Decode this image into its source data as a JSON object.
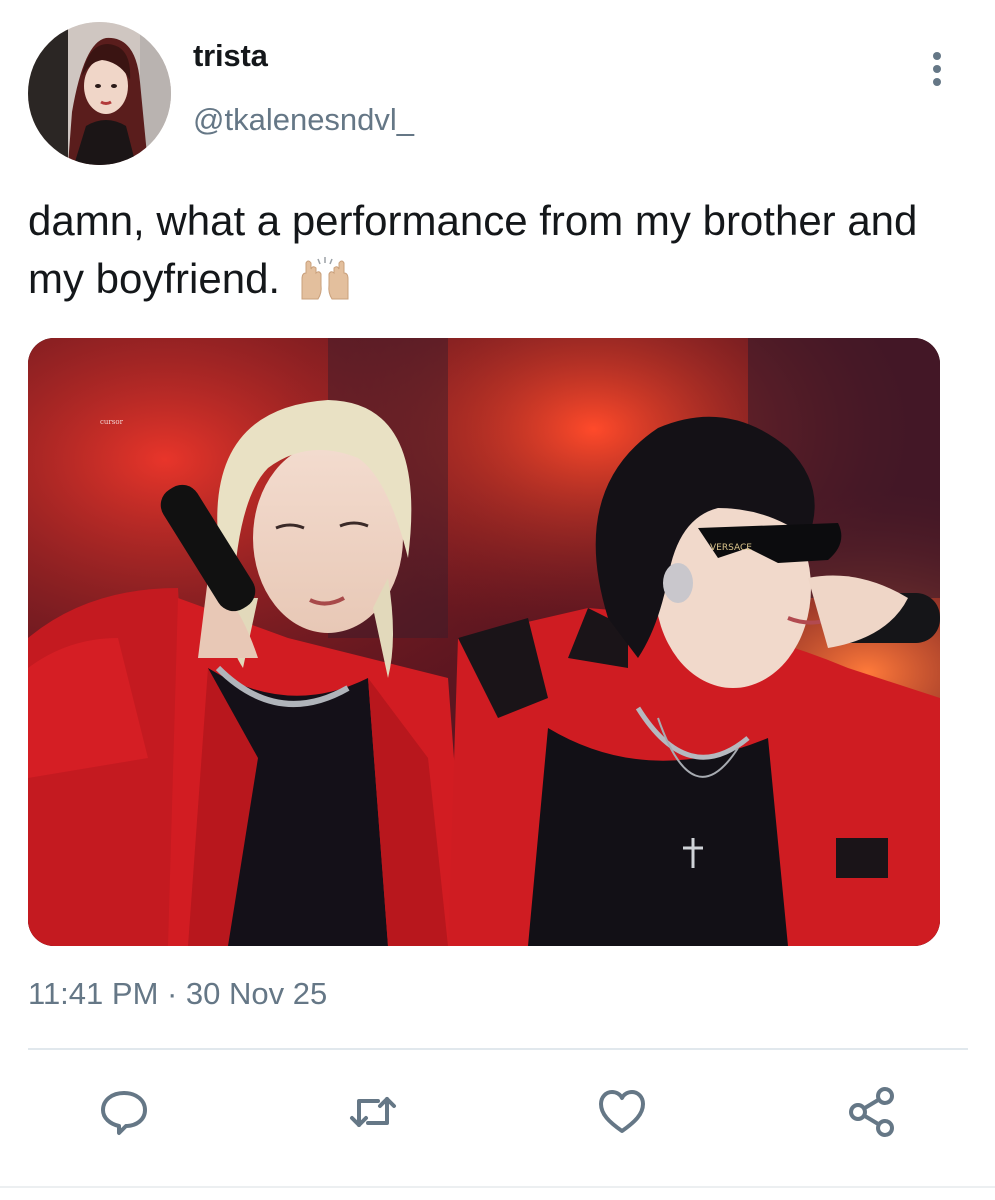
{
  "tweet": {
    "author": {
      "display_name": "trista",
      "handle": "@tkalenesndvl_"
    },
    "text": "damn, what a performance from my brother and my boyfriend.",
    "emoji": "raising-hands-emoji",
    "media": {
      "watermark": "cursor",
      "sunglasses_brand": "VERSACE"
    },
    "timestamp": "11:41 PM · 30 Nov 25"
  },
  "actions": {
    "reply_icon": "reply-icon",
    "retweet_icon": "retweet-icon",
    "like_icon": "heart-icon",
    "share_icon": "share-icon"
  },
  "colors": {
    "text_primary": "#14171a",
    "text_secondary": "#657786",
    "divider": "#e1e8ed",
    "icon": "#657786"
  }
}
